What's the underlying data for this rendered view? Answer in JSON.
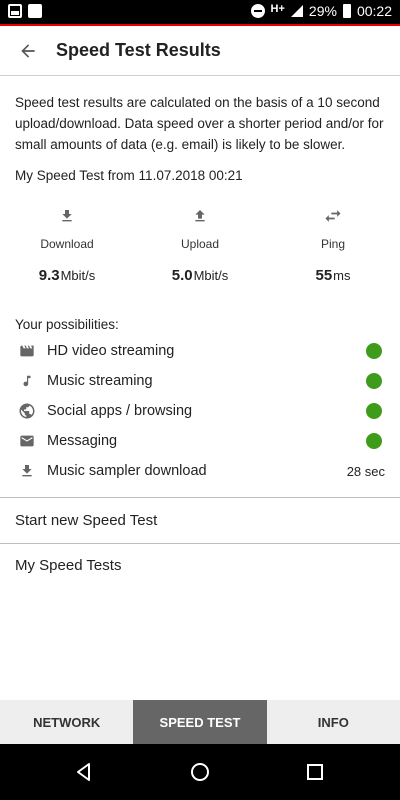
{
  "status": {
    "network": "H+",
    "battery": "29%",
    "time": "00:22"
  },
  "header": {
    "title": "Speed Test Results"
  },
  "intro": "Speed test results are calculated on the basis of a 10 second upload/download. Data speed over a shorter period and/or for small amounts of data (e.g. email) is likely to be slower.",
  "my_test": "My Speed Test from 11.07.2018 00:21",
  "metrics": [
    {
      "label": "Download",
      "value": "9.3",
      "unit": "Mbit/s",
      "icon": "download-icon"
    },
    {
      "label": "Upload",
      "value": "5.0",
      "unit": "Mbit/s",
      "icon": "upload-icon"
    },
    {
      "label": "Ping",
      "value": "55",
      "unit": "ms",
      "icon": "ping-icon"
    }
  ],
  "possibilities": {
    "title": "Your possibilities:",
    "items": [
      {
        "label": "HD video streaming",
        "icon": "video-icon",
        "status": "ok"
      },
      {
        "label": "Music streaming",
        "icon": "music-note-icon",
        "status": "ok"
      },
      {
        "label": "Social apps / browsing",
        "icon": "globe-icon",
        "status": "ok"
      },
      {
        "label": "Messaging",
        "icon": "mail-icon",
        "status": "ok"
      },
      {
        "label": "Music sampler download",
        "icon": "download-icon",
        "value": "28 sec"
      }
    ]
  },
  "actions": {
    "start_new": "Start new Speed Test",
    "my_tests": "My Speed Tests"
  },
  "tabs": [
    {
      "label": "NETWORK",
      "active": false
    },
    {
      "label": "SPEED TEST",
      "active": true
    },
    {
      "label": "INFO",
      "active": false
    }
  ],
  "colors": {
    "accent": "#e60000",
    "status_ok": "#3e9c1a",
    "active_tab": "#666666"
  }
}
